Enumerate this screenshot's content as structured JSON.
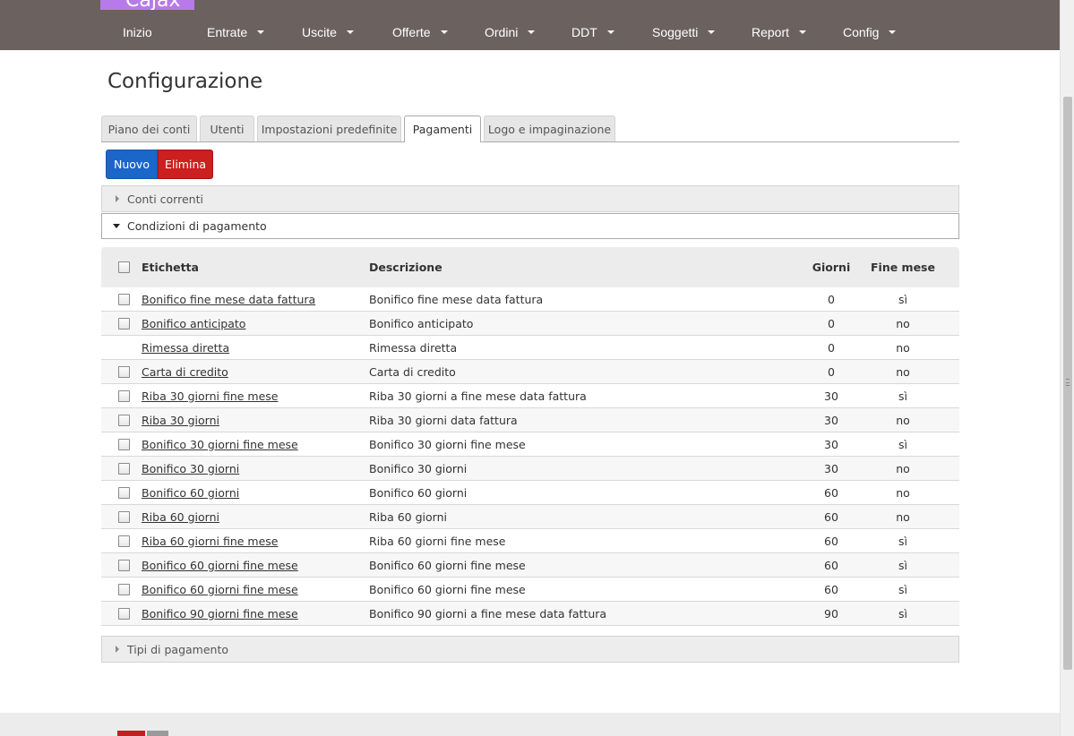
{
  "app": {
    "logo": "Cajax"
  },
  "nav": [
    {
      "label": "Inizio",
      "dropdown": false
    },
    {
      "label": "Entrate",
      "dropdown": true
    },
    {
      "label": "Uscite",
      "dropdown": true
    },
    {
      "label": "Offerte",
      "dropdown": true
    },
    {
      "label": "Ordini",
      "dropdown": true
    },
    {
      "label": "DDT",
      "dropdown": true
    },
    {
      "label": "Soggetti",
      "dropdown": true
    },
    {
      "label": "Report",
      "dropdown": true
    },
    {
      "label": "Config",
      "dropdown": true
    }
  ],
  "page": {
    "title": "Configurazione"
  },
  "tabs": [
    {
      "label": "Piano dei conti",
      "active": false
    },
    {
      "label": "Utenti",
      "active": false
    },
    {
      "label": "Impostazioni predefinite",
      "active": false
    },
    {
      "label": "Pagamenti",
      "active": true
    },
    {
      "label": "Logo e impaginazione",
      "active": false
    }
  ],
  "toolbar": {
    "new_label": "Nuovo",
    "delete_label": "Elimina"
  },
  "sections": {
    "conti": "Conti correnti",
    "condizioni": "Condizioni di pagamento",
    "tipi": "Tipi di pagamento"
  },
  "table": {
    "columns": {
      "etichetta": "Etichetta",
      "descrizione": "Descrizione",
      "giorni": "Giorni",
      "fine_mese": "Fine mese"
    },
    "rows": [
      {
        "etichetta": "Bonifico fine mese data fattura",
        "descrizione": "Bonifico fine mese data fattura",
        "giorni": "0",
        "fine_mese": "sì",
        "checkbox": true
      },
      {
        "etichetta": "Bonifico anticipato",
        "descrizione": "Bonifico anticipato",
        "giorni": "0",
        "fine_mese": "no",
        "checkbox": true
      },
      {
        "etichetta": "Rimessa diretta",
        "descrizione": "Rimessa diretta",
        "giorni": "0",
        "fine_mese": "no",
        "checkbox": false
      },
      {
        "etichetta": "Carta di credito",
        "descrizione": "Carta di credito",
        "giorni": "0",
        "fine_mese": "no",
        "checkbox": true
      },
      {
        "etichetta": "Riba 30 giorni fine mese",
        "descrizione": "Riba 30 giorni a fine mese data fattura",
        "giorni": "30",
        "fine_mese": "sì",
        "checkbox": true
      },
      {
        "etichetta": "Riba 30 giorni",
        "descrizione": "Riba 30 giorni data fattura",
        "giorni": "30",
        "fine_mese": "no",
        "checkbox": true
      },
      {
        "etichetta": "Bonifico 30 giorni fine mese",
        "descrizione": "Bonifico 30 giorni fine mese",
        "giorni": "30",
        "fine_mese": "sì",
        "checkbox": true
      },
      {
        "etichetta": "Bonifico 30 giorni",
        "descrizione": "Bonifico 30 giorni",
        "giorni": "30",
        "fine_mese": "no",
        "checkbox": true
      },
      {
        "etichetta": "Bonifico 60 giorni",
        "descrizione": "Bonifico 60 giorni",
        "giorni": "60",
        "fine_mese": "no",
        "checkbox": true
      },
      {
        "etichetta": "Riba 60 giorni",
        "descrizione": "Riba 60 giorni",
        "giorni": "60",
        "fine_mese": "no",
        "checkbox": true
      },
      {
        "etichetta": "Riba 60 giorni fine mese",
        "descrizione": "Riba 60 giorni fine mese",
        "giorni": "60",
        "fine_mese": "sì",
        "checkbox": true
      },
      {
        "etichetta": "Bonifico 60 giorni fine mese",
        "descrizione": "Bonifico 60 giorni fine mese",
        "giorni": "60",
        "fine_mese": "sì",
        "checkbox": true
      },
      {
        "etichetta": "Bonifico 60 giorni fine mese",
        "descrizione": "Bonifico 60 giorni fine mese",
        "giorni": "60",
        "fine_mese": "sì",
        "checkbox": true
      },
      {
        "etichetta": "Bonifico 90 giorni fine mese",
        "descrizione": "Bonifico 90 giorni a fine mese data fattura",
        "giorni": "90",
        "fine_mese": "sì",
        "checkbox": true
      }
    ]
  },
  "colors": {
    "topbar": "#6b625f",
    "logo": "#b77be9",
    "new_button": "#1b66c9",
    "delete_button": "#cc1f1f"
  }
}
